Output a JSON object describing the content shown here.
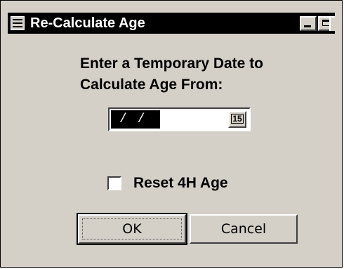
{
  "window": {
    "title": "Re-Calculate Age",
    "icon": "window-menu-icon",
    "controls": [
      "minimize-icon",
      "maximize-icon"
    ]
  },
  "prompt": {
    "text": "Enter a Temporary Date to\nCalculate Age From:"
  },
  "date_field": {
    "value": "/ /",
    "calendar_button_label": "15",
    "calendar_icon": "calendar-icon"
  },
  "checkbox": {
    "label": "Reset 4H Age",
    "checked": false
  },
  "buttons": {
    "ok_label": "OK",
    "cancel_label": "Cancel"
  }
}
